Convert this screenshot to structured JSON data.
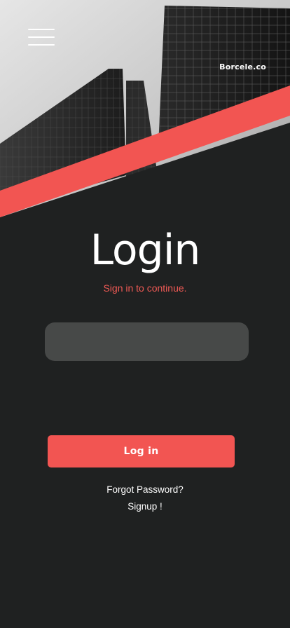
{
  "header": {
    "brand": "Borcele.co"
  },
  "main": {
    "title": "Login",
    "subtitle": "Sign in to continue.",
    "field": {
      "value": "",
      "placeholder": ""
    },
    "login_label": "Log in",
    "forgot_label": "Forgot Password?",
    "signup_label": "Signup !"
  },
  "colors": {
    "background": "#1f2121",
    "accent": "#f25552",
    "field": "#474948"
  },
  "icons": {
    "menu": "hamburger-menu-icon"
  }
}
